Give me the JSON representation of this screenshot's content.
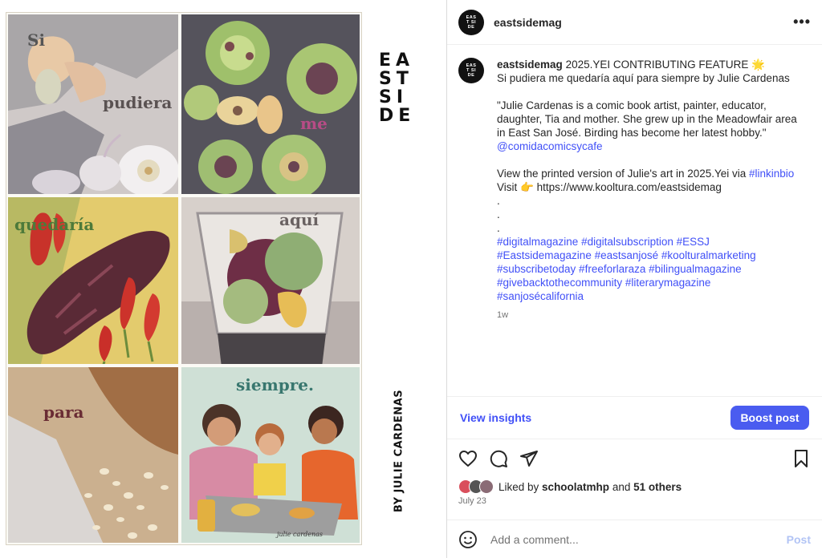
{
  "artwork": {
    "words": [
      "Si",
      "pudiera",
      "me",
      "quedaría",
      "aquí",
      "para",
      "siempre."
    ],
    "magazine_letters": [
      "EA",
      "ST",
      "SI",
      "DE"
    ],
    "byline": "BY JULIE CARDENAS",
    "signature": "julie cardenas"
  },
  "header": {
    "avatar_text": "EAST SIDE",
    "username": "eastsidemag",
    "more_icon": "more-horizontal-icon"
  },
  "caption": {
    "username": "eastsidemag",
    "title": "2025.YEI CONTRIBUTING FEATURE 🌟",
    "subtitle": "Si pudiera me quedaría aquí para siempre by Julie Cardenas",
    "quote_lines": [
      "\"Julie Cardenas is a comic book artist, painter, educator,",
      "daughter, Tia and mother. She grew up in the Meadowfair area",
      "in East San José. Birding has become her latest hobby.\""
    ],
    "mention": "@comidacomicsycafe",
    "printed_prefix": "View the printed version of Julie's art in 2025.Yei via ",
    "printed_link": "#linkinbio",
    "visit_line": "Visit 👉 https://www.kooltura.com/eastsidemag",
    "dots": [
      ".",
      ".",
      "."
    ],
    "hashtag_lines": [
      "#digitalmagazine #digitalsubscription #ESSJ",
      "#Eastsidemagazine #eastsanjosé #koolturalmarketing",
      "#subscribetoday #freeforlaraza #bilingualmagazine",
      "#givebacktothecommunity #literarymagazine",
      "#sanjosécalifornia"
    ],
    "time": "1w"
  },
  "insights": {
    "view_label": "View insights",
    "boost_label": "Boost post"
  },
  "actions": {
    "icons": [
      "heart-icon",
      "comment-icon",
      "share-icon",
      "bookmark-icon"
    ]
  },
  "likes": {
    "prefix": "Liked by ",
    "user": "schoolatmhp",
    "middle": " and ",
    "count": "51 others"
  },
  "date": "July 23",
  "comment": {
    "placeholder": "Add a comment...",
    "post_label": "Post"
  },
  "colors": {
    "accent": "#4150f7",
    "boost_bg": "#4a5cf0",
    "muted": "#737373"
  }
}
